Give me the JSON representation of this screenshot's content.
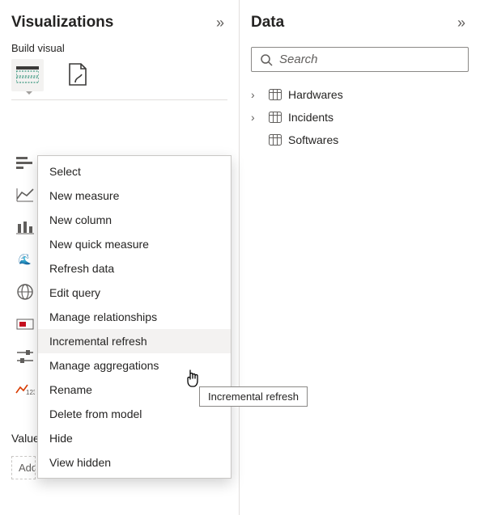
{
  "viz": {
    "title": "Visualizations",
    "build_label": "Build visual",
    "values_label": "Values",
    "add_field_placeholder": "Add data fields here"
  },
  "data": {
    "title": "Data",
    "search_placeholder": "Search",
    "tables": [
      {
        "name": "Hardwares"
      },
      {
        "name": "Incidents"
      },
      {
        "name": "Softwares"
      }
    ]
  },
  "context_menu": {
    "items": [
      "Select",
      "New measure",
      "New column",
      "New quick measure",
      "Refresh data",
      "Edit query",
      "Manage relationships",
      "Incremental refresh",
      "Manage aggregations",
      "Rename",
      "Delete from model",
      "Hide",
      "View hidden"
    ],
    "hovered_index": 7
  },
  "tooltip": {
    "text": "Incremental refresh"
  }
}
